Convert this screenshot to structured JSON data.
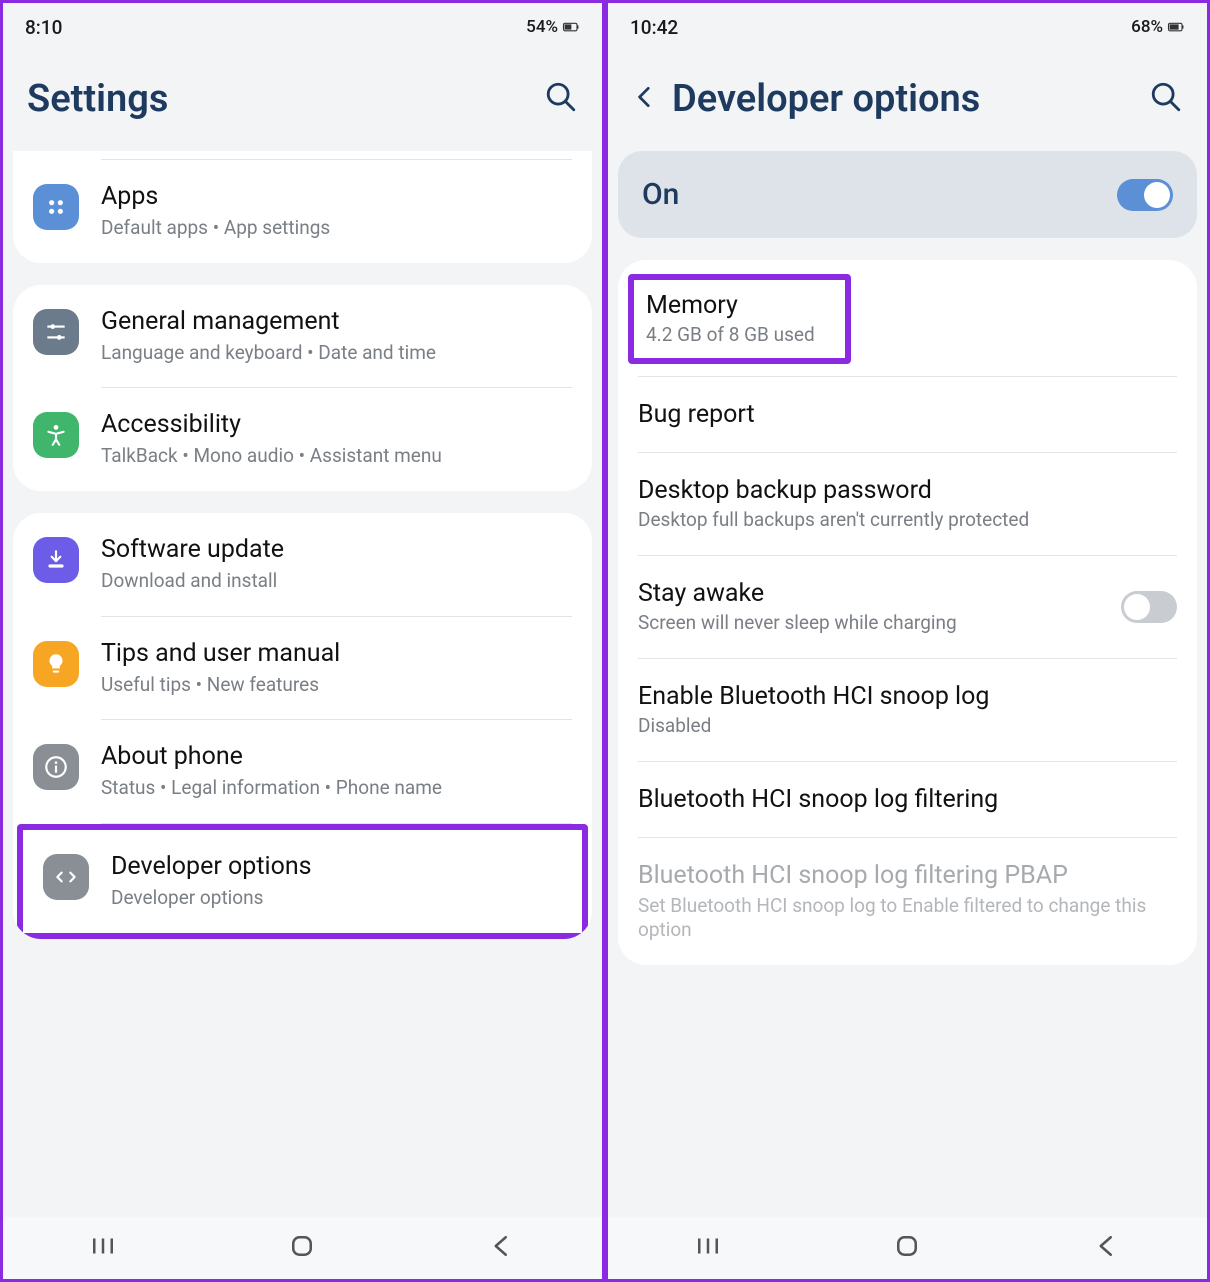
{
  "left": {
    "status": {
      "time": "8:10",
      "battery": "54%"
    },
    "header": {
      "title": "Settings"
    },
    "groups": [
      {
        "rows": [
          {
            "key": "apps",
            "icon_color": "#5b8fd6",
            "title": "Apps",
            "sub": "Default apps  •  App settings"
          }
        ]
      },
      {
        "rows": [
          {
            "key": "general",
            "icon_color": "#6b7b8c",
            "title": "General management",
            "sub": "Language and keyboard  •  Date and time"
          },
          {
            "key": "accessibility",
            "icon_color": "#3fb66b",
            "title": "Accessibility",
            "sub": "TalkBack  •  Mono audio  •  Assistant menu"
          }
        ]
      },
      {
        "rows": [
          {
            "key": "software",
            "icon_color": "#6c5ce7",
            "title": "Software update",
            "sub": "Download and install"
          },
          {
            "key": "tips",
            "icon_color": "#f6a623",
            "title": "Tips and user manual",
            "sub": "Useful tips  •  New features"
          },
          {
            "key": "about",
            "icon_color": "#8a8f95",
            "title": "About phone",
            "sub": "Status  •  Legal information  •  Phone name"
          },
          {
            "key": "dev",
            "icon_color": "#8a8f95",
            "title": "Developer options",
            "sub": "Developer options",
            "highlight": true
          }
        ]
      }
    ]
  },
  "right": {
    "status": {
      "time": "10:42",
      "battery": "68%"
    },
    "header": {
      "title": "Developer options"
    },
    "master_toggle": {
      "label": "On",
      "state": "on"
    },
    "rows": [
      {
        "key": "memory",
        "title": "Memory",
        "sub": "4.2 GB of 8 GB used",
        "highlight": true
      },
      {
        "key": "bug",
        "title": "Bug report"
      },
      {
        "key": "backup",
        "title": "Desktop backup password",
        "sub": "Desktop full backups aren't currently protected"
      },
      {
        "key": "stay",
        "title": "Stay awake",
        "sub": "Screen will never sleep while charging",
        "toggle": "off"
      },
      {
        "key": "bt_hci",
        "title": "Enable Bluetooth HCI snoop log",
        "sub": "Disabled"
      },
      {
        "key": "bt_filter",
        "title": "Bluetooth HCI snoop log filtering"
      },
      {
        "key": "bt_pbap",
        "title": "Bluetooth HCI snoop log filtering PBAP",
        "sub": "Set Bluetooth HCI snoop log to Enable filtered to change this option",
        "disabled": true
      }
    ]
  }
}
